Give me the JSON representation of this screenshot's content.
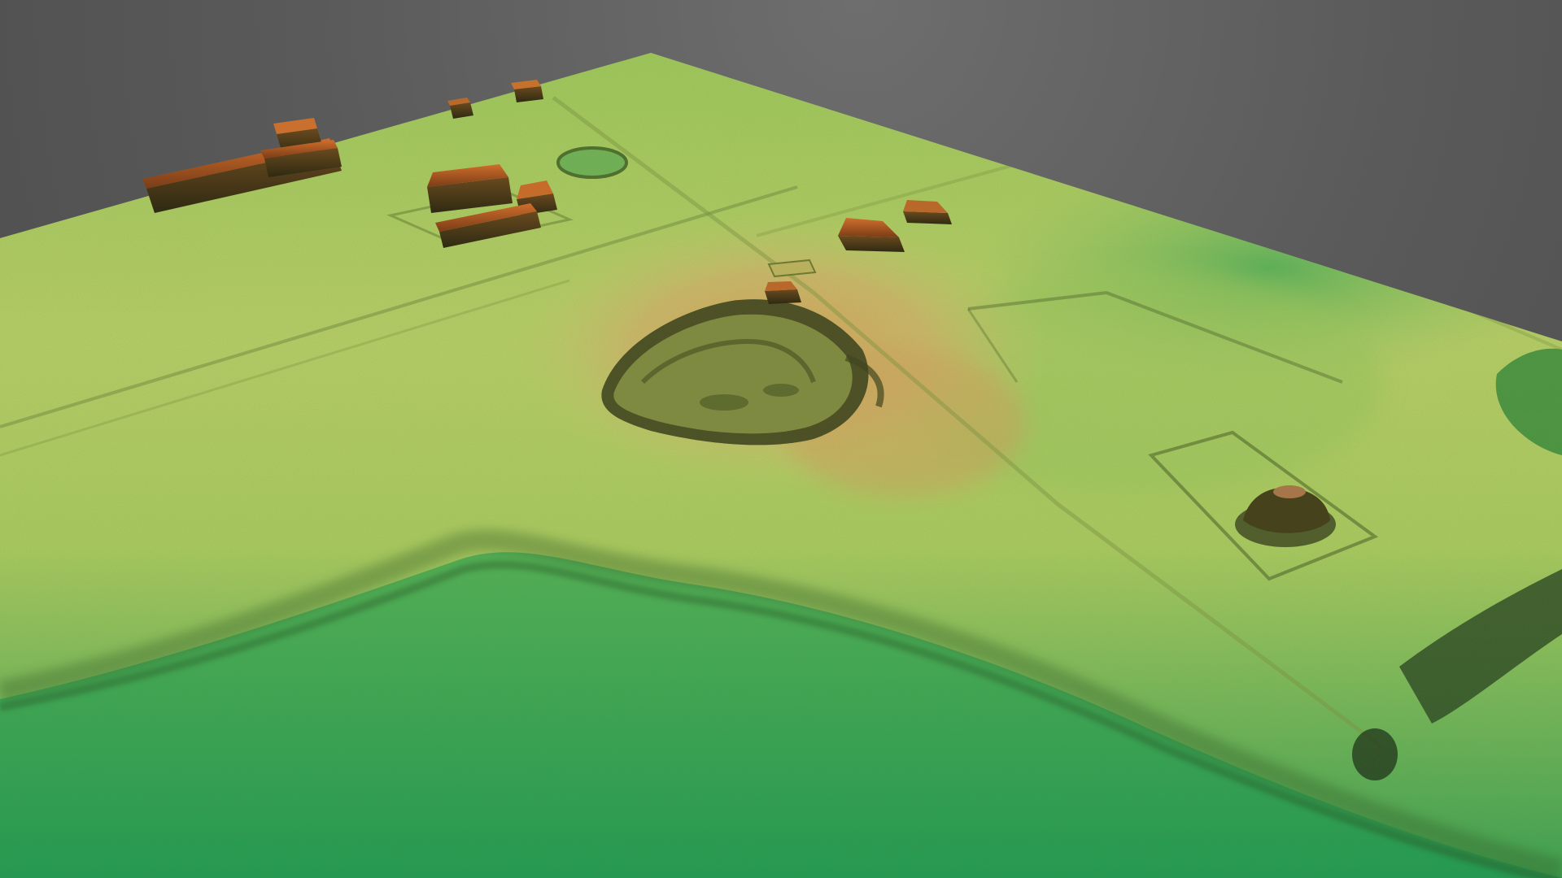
{
  "viewer": {
    "type": "3d-terrain-model",
    "background_color": "#5c5c5c"
  },
  "terrain": {
    "colormap": [
      "#1f9a4e",
      "#3fae4f",
      "#8cc152",
      "#c7cf6a",
      "#d6a55a",
      "#c06a2c",
      "#9b4a1e"
    ],
    "features": [
      {
        "kind": "building",
        "count": 9
      },
      {
        "kind": "excavation-pit",
        "count": 1
      },
      {
        "kind": "enclosure",
        "count": 3
      }
    ]
  }
}
